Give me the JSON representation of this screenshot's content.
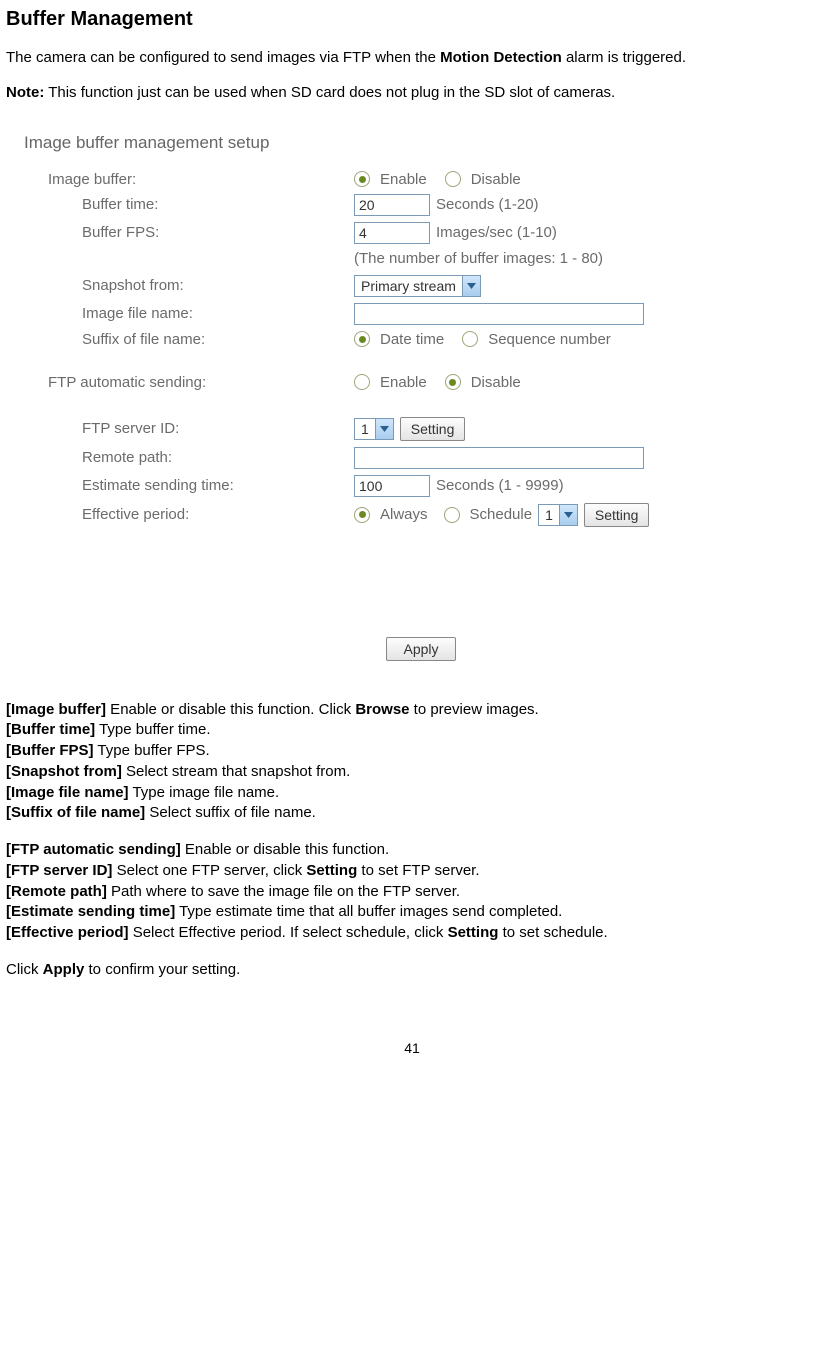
{
  "title": "Buffer Management",
  "intro": {
    "before": "The camera can be configured to send images via FTP when the ",
    "bold": "Motion Detection",
    "after": " alarm is triggered."
  },
  "note": {
    "label": "Note:",
    "text": " This function just can be used when SD card does not plug in the SD slot of cameras."
  },
  "setup": {
    "heading": "Image buffer management setup",
    "image_buffer": {
      "label": "Image buffer:",
      "enable": "Enable",
      "disable": "Disable"
    },
    "buffer_time": {
      "label": "Buffer time:",
      "value": "20",
      "suffix": "Seconds (1-20)"
    },
    "buffer_fps": {
      "label": "Buffer FPS:",
      "value": "4",
      "suffix": "Images/sec (1-10)"
    },
    "buffer_hint": "(The number of buffer images: 1 - 80)",
    "snapshot_from": {
      "label": "Snapshot from:",
      "value": "Primary stream"
    },
    "image_file_name": {
      "label": "Image file name:",
      "value": ""
    },
    "suffix_file": {
      "label": "Suffix of file name:",
      "opt1": "Date time",
      "opt2": "Sequence number"
    },
    "ftp_auto": {
      "label": "FTP automatic sending:",
      "enable": "Enable",
      "disable": "Disable"
    },
    "ftp_server_id": {
      "label": "FTP server ID:",
      "value": "1",
      "button": "Setting"
    },
    "remote_path": {
      "label": "Remote path:",
      "value": ""
    },
    "est_send": {
      "label": "Estimate sending time:",
      "value": "100",
      "suffix": "Seconds (1 - 9999)"
    },
    "effective": {
      "label": "Effective period:",
      "always": "Always",
      "schedule": "Schedule",
      "schedule_value": "1",
      "button": "Setting"
    },
    "apply": "Apply"
  },
  "defs1": [
    {
      "term": "[Image buffer]",
      "desc_before": " Enable or disable this function. Click ",
      "bold": "Browse",
      "desc_after": " to preview images."
    },
    {
      "term": "[Buffer time]",
      "desc_before": " Type buffer time.",
      "bold": "",
      "desc_after": ""
    },
    {
      "term": "[Buffer FPS]",
      "desc_before": " Type buffer FPS.",
      "bold": "",
      "desc_after": ""
    },
    {
      "term": "[Snapshot from]",
      "desc_before": " Select stream that snapshot from.",
      "bold": "",
      "desc_after": ""
    },
    {
      "term": "[Image file name]",
      "desc_before": " Type image file name.",
      "bold": "",
      "desc_after": ""
    },
    {
      "term": "[Suffix of file name]",
      "desc_before": " Select suffix of file name.",
      "bold": "",
      "desc_after": ""
    }
  ],
  "defs2": [
    {
      "term": "[FTP automatic sending]",
      "desc_before": " Enable or disable this function.",
      "bold": "",
      "desc_after": ""
    },
    {
      "term": "[FTP server ID]",
      "desc_before": " Select one FTP server, click ",
      "bold": "Setting",
      "desc_after": " to set FTP server."
    },
    {
      "term": "[Remote path]",
      "desc_before": " Path where to save the image file on the FTP server.",
      "bold": "",
      "desc_after": ""
    },
    {
      "term": "[Estimate sending time]",
      "desc_before": " Type estimate time that all buffer images send completed.",
      "bold": "",
      "desc_after": ""
    },
    {
      "term": "[Effective period]",
      "desc_before": " Select Effective period. If select schedule, click ",
      "bold": "Setting",
      "desc_after": " to set schedule."
    }
  ],
  "closing": {
    "before": "Click ",
    "bold": "Apply",
    "after": " to confirm your setting."
  },
  "page_number": "41"
}
